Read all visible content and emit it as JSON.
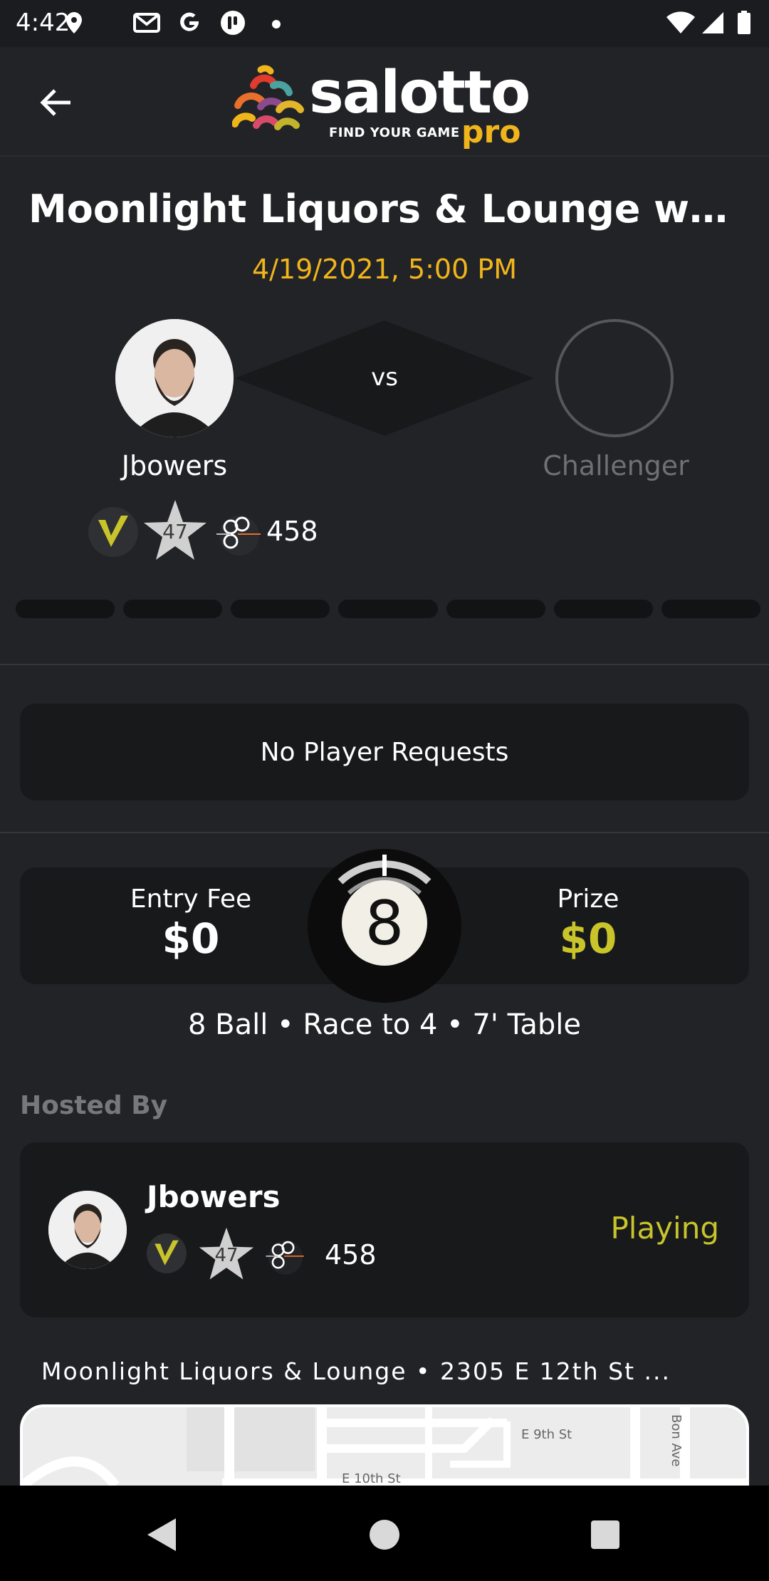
{
  "status_bar": {
    "time": "4:42",
    "left_icons": [
      "location-icon",
      "gmail-icon",
      "google-icon",
      "app-notification-icon",
      "more-dot-icon"
    ],
    "right_icons": [
      "wifi-icon",
      "signal-icon",
      "battery-icon"
    ]
  },
  "header": {
    "back_icon": "arrow-left-icon",
    "logo_text": "salotto",
    "logo_tagline": "FIND YOUR GAME",
    "logo_pro": "pro"
  },
  "event": {
    "title": "Moonlight Liquors & Lounge with...",
    "datetime": "4/19/2021, 5:00 PM"
  },
  "match": {
    "vs_label": "vs",
    "player": {
      "name": "Jbowers",
      "rating_star": "47",
      "score": "458"
    },
    "challenger_label": "Challenger",
    "race_segments": 7
  },
  "requests": {
    "empty_text": "No Player Requests"
  },
  "fees": {
    "entry_label": "Entry Fee",
    "entry_value": "$0",
    "prize_label": "Prize",
    "prize_value": "$0",
    "ball_number": "8"
  },
  "game_info": "8 Ball • Race to 4 • 7' Table",
  "host": {
    "section_label": "Hosted By",
    "name": "Jbowers",
    "rating_star": "47",
    "score": "458",
    "status": "Playing"
  },
  "venue": {
    "line": "Moonlight Liquors & Lounge • 2305 E 12th St ...",
    "map_labels": [
      "E 9th St",
      "E 10th St",
      "Bon Ave"
    ]
  },
  "colors": {
    "background": "#222327",
    "card": "#18191b",
    "accent_gold": "#f1b51c",
    "accent_olive": "#c8c42a"
  }
}
